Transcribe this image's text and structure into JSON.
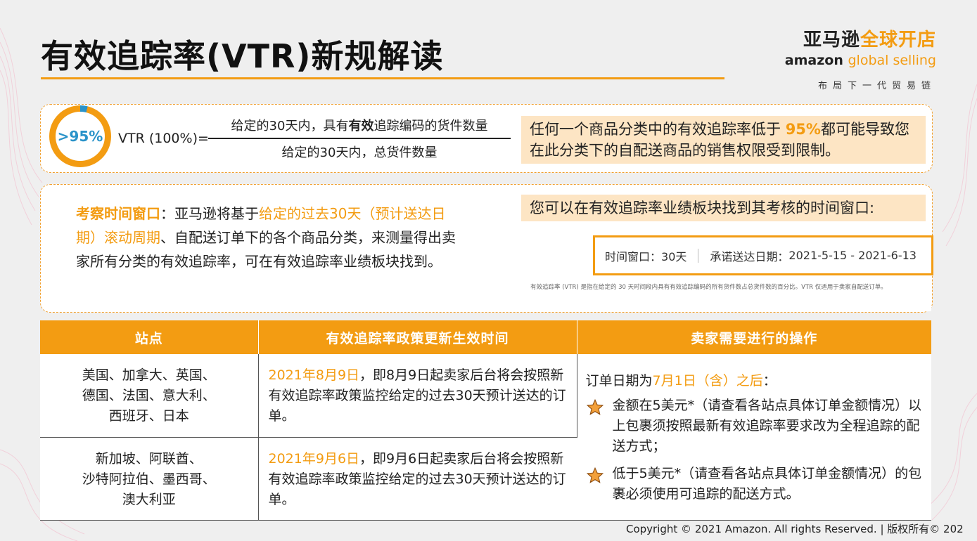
{
  "slide": {
    "title": "有效追踪率(VTR)新规解读"
  },
  "logo": {
    "line1_a": "亚马逊",
    "line1_b": "全球开店",
    "line2_a": "amazon",
    "line2_b": "global selling",
    "tagline": "布局下一代贸易链"
  },
  "formula": {
    "ring_label": ">95%",
    "lhs": "VTR (100%)=",
    "numerator_pre": "给定的30天内，具有",
    "numerator_bold": "有效",
    "numerator_post": "追踪编码的货件数量",
    "denominator": "给定的30天内，总货件数量"
  },
  "callout_top": {
    "pre": "任何一个商品分类中的有效追踪率低于 ",
    "highlight": "95%",
    "post": "都可能导致您在此分类下的自配送商品的销售权限受到限制。"
  },
  "window": {
    "label": "考察时间窗口",
    "sep": "：亚马逊将基于",
    "highlight": "给定的过去30天（预计送达日期）滚动周期",
    "rest": "、自配送订单下的各个商品分类，来测量得出卖家所有分类的有效追踪率，可在有效追踪率业绩板块找到。"
  },
  "callout_mid": {
    "text": "您可以在有效追踪率业绩板块找到其考核的时间窗口:"
  },
  "screenshot": {
    "window_label": "时间窗口：",
    "window_value": "30天",
    "date_label": "承诺送达日期：",
    "date_value": "2021-5-15 - 2021-6-13",
    "fine_print": "有效追踪率 (VTR) 是指在给定的 30 天时间段内具有有效追踪编码的所有货件数占总货件数的百分比。VTR 仅适用于卖家自配送订单。"
  },
  "table": {
    "headers": [
      "站点",
      "有效追踪率政策更新生效时间",
      "卖家需要进行的操作"
    ],
    "rows": [
      {
        "sites": [
          "美国、加拿大、英国、",
          "德国、法国、意大利、",
          "西班牙、日本"
        ],
        "date": "2021年8月9日",
        "desc": "，即8月9日起卖家后台将会按照新有效追踪率政策监控给定的过去30天预计送达的订单。"
      },
      {
        "sites": [
          "新加坡、阿联酋、",
          "沙特阿拉伯、墨西哥、",
          "澳大利亚"
        ],
        "date": "2021年9月6日",
        "desc": "，即9月6日起卖家后台将会按照新有效追踪率政策监控给定的过去30天预计送达的订单。"
      }
    ],
    "action": {
      "intro_pre": "订单日期为",
      "intro_date": "7月1日（含）之后",
      "intro_post": "：",
      "bullets": [
        "金额在5美元*（请查看各站点具体订单金额情况）以上包裹须按照最新有效追踪率要求改为全程追踪的配送方式；",
        "低于5美元*（请查看各站点具体订单金额情况）的包裹必须使用可追踪的配送方式。"
      ],
      "bullet_icon": "star-icon"
    }
  },
  "footer": {
    "copyright": "Copyright © 2021 Amazon. All rights Reserved. | 版权所有© 202"
  },
  "colors": {
    "accent": "#f39c12",
    "ring_blue": "#2a93c9",
    "callout_bg": "#fde5c4"
  }
}
